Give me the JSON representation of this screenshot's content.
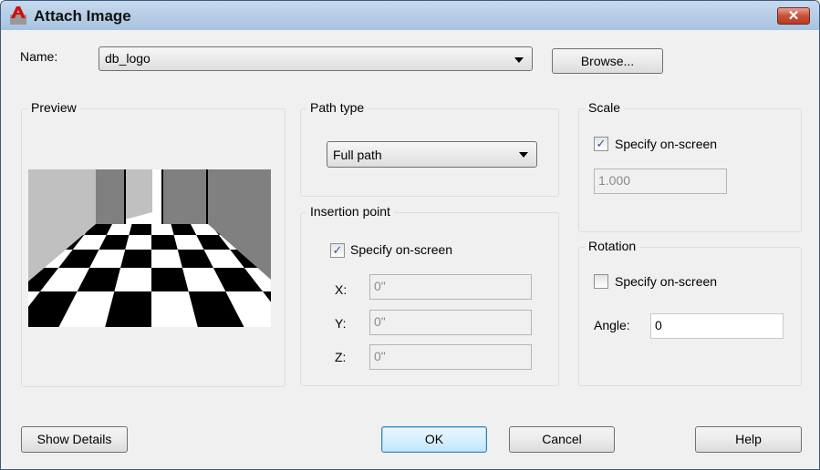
{
  "window": {
    "title": "Attach Image",
    "close_icon": "close-icon",
    "accent": "#3c7fb1"
  },
  "name": {
    "label": "Name:",
    "value": "db_logo",
    "browse": "Browse..."
  },
  "preview": {
    "label": "Preview"
  },
  "path_type": {
    "label": "Path type",
    "value": "Full path"
  },
  "insertion": {
    "label": "Insertion point",
    "specify": "Specify on-screen",
    "specify_checked": true,
    "x_label": "X:",
    "x": "0\"",
    "y_label": "Y:",
    "y": "0\"",
    "z_label": "Z:",
    "z": "0\""
  },
  "scale": {
    "label": "Scale",
    "specify": "Specify on-screen",
    "specify_checked": true,
    "value": "1.000"
  },
  "rotation": {
    "label": "Rotation",
    "specify": "Specify on-screen",
    "specify_checked": false,
    "angle_label": "Angle:",
    "angle": "0"
  },
  "buttons": {
    "details": "Show Details",
    "ok": "OK",
    "cancel": "Cancel",
    "help": "Help"
  }
}
